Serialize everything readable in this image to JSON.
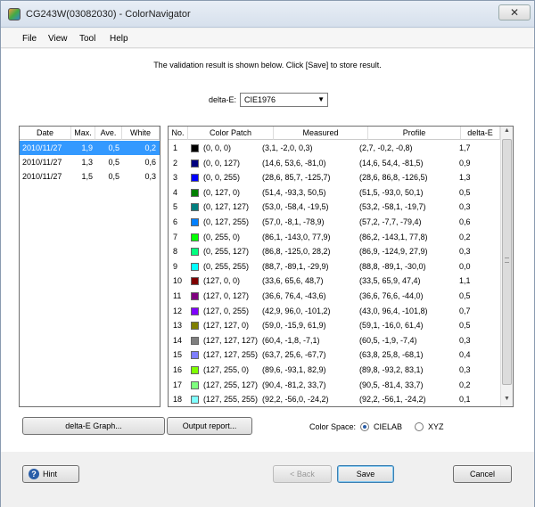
{
  "window": {
    "title": "CG243W(03082030) - ColorNavigator",
    "close_glyph": "✕"
  },
  "menu": [
    "File",
    "View",
    "Tool",
    "Help"
  ],
  "info_text": "The validation result is shown below.  Click [Save] to store result.",
  "delta_e": {
    "label": "delta-E:",
    "selected": "CIE1976"
  },
  "summary_table": {
    "headers": [
      "Date",
      "Max.",
      "Ave.",
      "White"
    ],
    "rows": [
      [
        "2010/11/27",
        "1,9",
        "0,5",
        "0,2"
      ],
      [
        "2010/11/27",
        "1,3",
        "0,5",
        "0,6"
      ],
      [
        "2010/11/27",
        "1,5",
        "0,5",
        "0,3"
      ]
    ]
  },
  "detail_table": {
    "headers": [
      "No.",
      "Color Patch",
      "Measured",
      "Profile",
      "delta-E"
    ],
    "rows": [
      {
        "no": "1",
        "color": "#000000",
        "patch": "(0, 0, 0)",
        "measured": "(3,1, -2,0, 0,3)",
        "profile": "(2,7, -0,2, -0,8)",
        "de": "1,7"
      },
      {
        "no": "2",
        "color": "#00007f",
        "patch": "(0, 0, 127)",
        "measured": "(14,6, 53,6, -81,0)",
        "profile": "(14,6, 54,4, -81,5)",
        "de": "0,9"
      },
      {
        "no": "3",
        "color": "#0000ff",
        "patch": "(0, 0, 255)",
        "measured": "(28,6, 85,7, -125,7)",
        "profile": "(28,6, 86,8, -126,5)",
        "de": "1,3"
      },
      {
        "no": "4",
        "color": "#007f00",
        "patch": "(0, 127, 0)",
        "measured": "(51,4, -93,3, 50,5)",
        "profile": "(51,5, -93,0, 50,1)",
        "de": "0,5"
      },
      {
        "no": "5",
        "color": "#007f7f",
        "patch": "(0, 127, 127)",
        "measured": "(53,0, -58,4, -19,5)",
        "profile": "(53,2, -58,1, -19,7)",
        "de": "0,3"
      },
      {
        "no": "6",
        "color": "#007fff",
        "patch": "(0, 127, 255)",
        "measured": "(57,0, -8,1, -78,9)",
        "profile": "(57,2, -7,7, -79,4)",
        "de": "0,6"
      },
      {
        "no": "7",
        "color": "#00ff00",
        "patch": "(0, 255, 0)",
        "measured": "(86,1, -143,0, 77,9)",
        "profile": "(86,2, -143,1, 77,8)",
        "de": "0,2"
      },
      {
        "no": "8",
        "color": "#00ff7f",
        "patch": "(0, 255, 127)",
        "measured": "(86,8, -125,0, 28,2)",
        "profile": "(86,9, -124,9, 27,9)",
        "de": "0,3"
      },
      {
        "no": "9",
        "color": "#00ffff",
        "patch": "(0, 255, 255)",
        "measured": "(88,7, -89,1, -29,9)",
        "profile": "(88,8, -89,1, -30,0)",
        "de": "0,0"
      },
      {
        "no": "10",
        "color": "#7f0000",
        "patch": "(127, 0, 0)",
        "measured": "(33,6, 65,6, 48,7)",
        "profile": "(33,5, 65,9, 47,4)",
        "de": "1,1"
      },
      {
        "no": "11",
        "color": "#7f007f",
        "patch": "(127, 0, 127)",
        "measured": "(36,6, 76,4, -43,6)",
        "profile": "(36,6, 76,6, -44,0)",
        "de": "0,5"
      },
      {
        "no": "12",
        "color": "#7f00ff",
        "patch": "(127, 0, 255)",
        "measured": "(42,9, 96,0, -101,2)",
        "profile": "(43,0, 96,4, -101,8)",
        "de": "0,7"
      },
      {
        "no": "13",
        "color": "#7f7f00",
        "patch": "(127, 127, 0)",
        "measured": "(59,0, -15,9, 61,9)",
        "profile": "(59,1, -16,0, 61,4)",
        "de": "0,5"
      },
      {
        "no": "14",
        "color": "#7f7f7f",
        "patch": "(127, 127, 127)",
        "measured": "(60,4, -1,8, -7,1)",
        "profile": "(60,5, -1,9, -7,4)",
        "de": "0,3"
      },
      {
        "no": "15",
        "color": "#7f7fff",
        "patch": "(127, 127, 255)",
        "measured": "(63,7, 25,6, -67,7)",
        "profile": "(63,8, 25,8, -68,1)",
        "de": "0,4"
      },
      {
        "no": "16",
        "color": "#7fff00",
        "patch": "(127, 255, 0)",
        "measured": "(89,6, -93,1, 82,9)",
        "profile": "(89,8, -93,2, 83,1)",
        "de": "0,3"
      },
      {
        "no": "17",
        "color": "#7fff7f",
        "patch": "(127, 255, 127)",
        "measured": "(90,4, -81,2, 33,7)",
        "profile": "(90,5, -81,4, 33,7)",
        "de": "0,2"
      },
      {
        "no": "18",
        "color": "#7fffff",
        "patch": "(127, 255, 255)",
        "measured": "(92,2, -56,0, -24,2)",
        "profile": "(92,2, -56,1, -24,2)",
        "de": "0,1"
      }
    ]
  },
  "buttons": {
    "graph": "delta-E Graph...",
    "report": "Output report...",
    "hint": "Hint",
    "back": "< Back",
    "save": "Save",
    "cancel": "Cancel"
  },
  "color_space": {
    "label": "Color Space:",
    "options": [
      "CIELAB",
      "XYZ"
    ],
    "selected": "CIELAB"
  },
  "colors": {
    "selection": "#3399ff",
    "hint_icon": "#2a5ea8"
  },
  "icons": {
    "app": "color-navigator-icon",
    "hint": "question-icon",
    "dropdown": "chevron-down-icon"
  }
}
